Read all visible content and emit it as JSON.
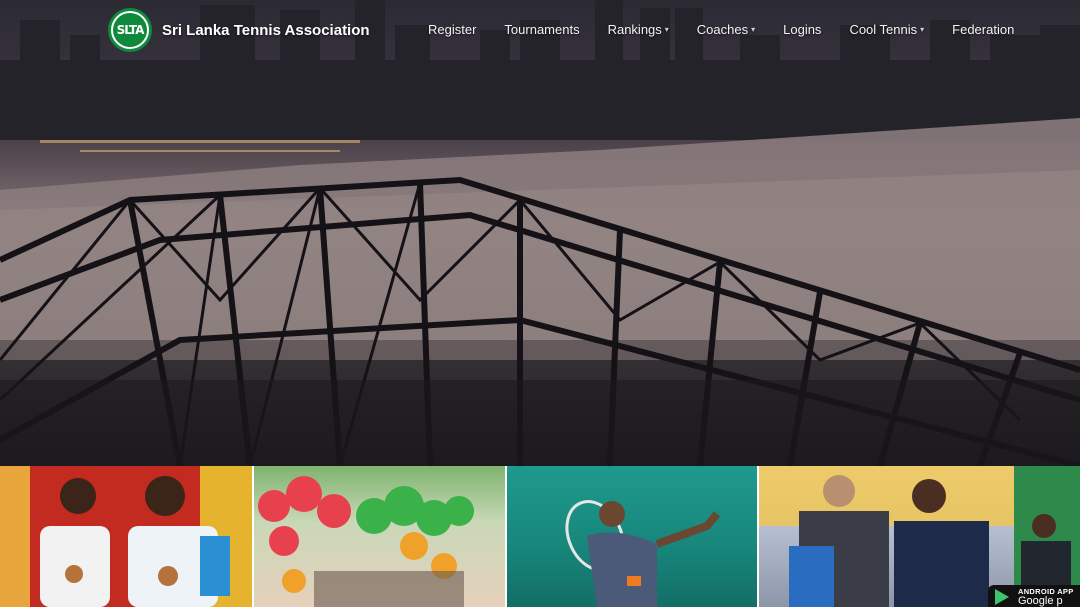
{
  "site": {
    "logo_text": "SLTA",
    "brand": "Sri Lanka Tennis Association"
  },
  "nav": {
    "items": [
      {
        "label": "Register",
        "dropdown": false
      },
      {
        "label": "Tournaments",
        "dropdown": false
      },
      {
        "label": "Rankings",
        "dropdown": true
      },
      {
        "label": "Coaches",
        "dropdown": true
      },
      {
        "label": "Logins",
        "dropdown": false
      },
      {
        "label": "Cool Tennis",
        "dropdown": true
      },
      {
        "label": "Federation",
        "dropdown": false
      }
    ]
  },
  "tiles": [
    {
      "name": "medal-winners-photo"
    },
    {
      "name": "balloons-celebration-photo"
    },
    {
      "name": "tennis-player-photo"
    },
    {
      "name": "award-ceremony-photo"
    }
  ],
  "badge": {
    "line1": "ANDROID APP",
    "line2": "Google p",
    "icon": "google-play-icon"
  },
  "colors": {
    "logo_green": "#0f8a3c",
    "nav_text": "#f2f2f2"
  }
}
